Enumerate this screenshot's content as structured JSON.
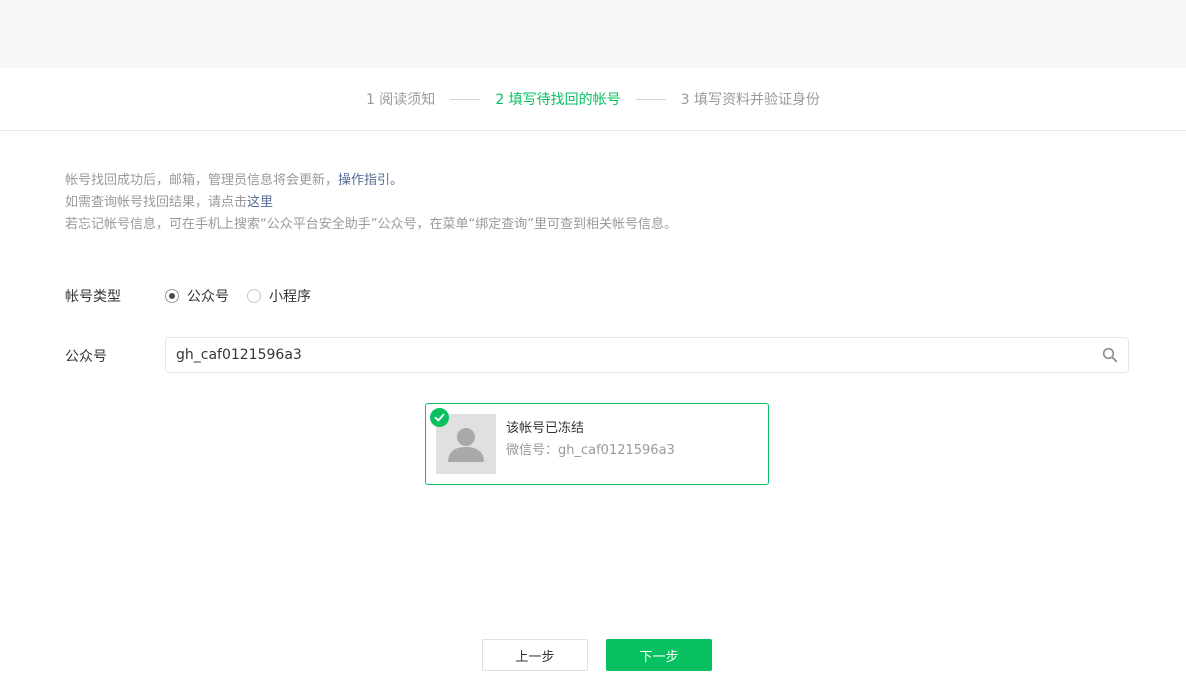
{
  "steps": [
    {
      "label": "1 阅读须知",
      "active": false
    },
    {
      "label": "2 填写待找回的帐号",
      "active": true
    },
    {
      "label": "3 填写资料并验证身份",
      "active": false
    }
  ],
  "notice": {
    "line1_text": "帐号找回成功后，邮箱，管理员信息将会更新，",
    "line1_link": "操作指引。",
    "line2_text": "如需查询帐号找回结果，请点击",
    "line2_link": "这里",
    "line3_text": "若忘记帐号信息，可在手机上搜索“公众平台安全助手”公众号，在菜单“绑定查询”里可查到相关帐号信息。"
  },
  "account_type": {
    "label": "帐号类型",
    "options": [
      "公众号",
      "小程序"
    ],
    "selected": "公众号"
  },
  "account_field": {
    "label": "公众号",
    "value": "gh_caf0121596a3"
  },
  "result_card": {
    "name": "该帐号已冻结",
    "wechat_id": "微信号：gh_caf0121596a3",
    "accent": "#07c160"
  },
  "buttons": {
    "prev": "上一步",
    "next": "下一步"
  },
  "icons": {
    "search": "search-icon",
    "check": "check-icon",
    "avatar": "user-silhouette-icon"
  },
  "colors": {
    "accent": "#07c160",
    "link": "#576b95",
    "muted": "#9a9a9a"
  }
}
